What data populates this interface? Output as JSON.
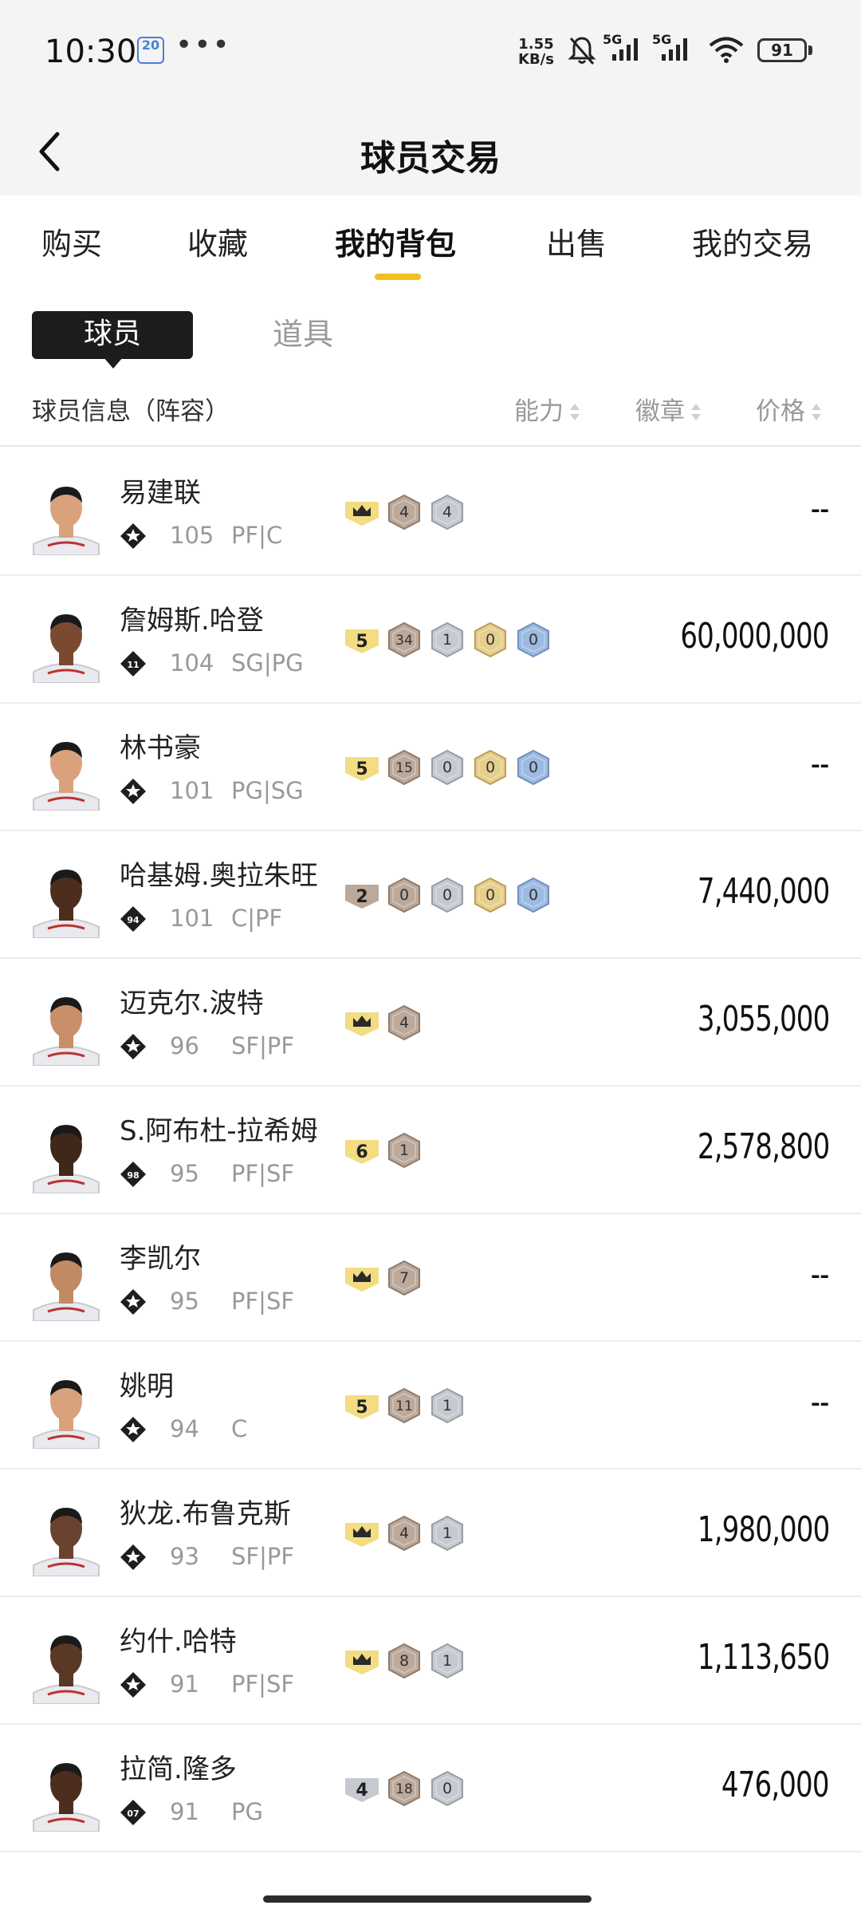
{
  "status_bar": {
    "time": "10:30",
    "calendar_day": "20",
    "dots": "•••",
    "net_speed_value": "1.55",
    "net_speed_unit": "KB/s",
    "signal1": "5G",
    "signal2": "5G",
    "battery": "91"
  },
  "header": {
    "title": "球员交易",
    "back_icon": "chevron-left-icon"
  },
  "tabs": [
    {
      "label": "购买",
      "active": false
    },
    {
      "label": "收藏",
      "active": false
    },
    {
      "label": "我的背包",
      "active": true
    },
    {
      "label": "出售",
      "active": false
    },
    {
      "label": "我的交易",
      "active": false
    }
  ],
  "segment": {
    "players": "球员",
    "items": "道具"
  },
  "columns": {
    "info": "球员信息（阵容）",
    "ability": "能力",
    "badge": "徽章",
    "price": "价格"
  },
  "colors": {
    "accent": "#f2c01e",
    "gold_chip": "#f3dc82",
    "bronze_chip": "#bca99a",
    "silver_chip": "#c7c9d1",
    "hof_chip": "#e5cf8e",
    "blue_chip": "#9dbbe0"
  },
  "players": [
    {
      "name": "易建联",
      "badge_label": "",
      "rating": "105",
      "position": "PF|C",
      "price": "--",
      "tier": {
        "kind": "crown",
        "label": ""
      },
      "chips": [
        {
          "color": "bronze",
          "value": "4"
        },
        {
          "color": "silver",
          "value": "4"
        }
      ]
    },
    {
      "name": "詹姆斯.哈登",
      "badge_label": "11",
      "rating": "104",
      "position": "SG|PG",
      "price": "60,000,000",
      "tier": {
        "kind": "gold",
        "label": "5"
      },
      "chips": [
        {
          "color": "bronze",
          "value": "34"
        },
        {
          "color": "silver",
          "value": "1"
        },
        {
          "color": "hof",
          "value": "0"
        },
        {
          "color": "blue",
          "value": "0"
        }
      ]
    },
    {
      "name": "林书豪",
      "badge_label": "",
      "rating": "101",
      "position": "PG|SG",
      "price": "--",
      "tier": {
        "kind": "gold",
        "label": "5"
      },
      "chips": [
        {
          "color": "bronze",
          "value": "15"
        },
        {
          "color": "silver",
          "value": "0"
        },
        {
          "color": "hof",
          "value": "0"
        },
        {
          "color": "blue",
          "value": "0"
        }
      ]
    },
    {
      "name": "哈基姆.奥拉朱旺",
      "badge_label": "94",
      "rating": "101",
      "position": "C|PF",
      "price": "7,440,000",
      "tier": {
        "kind": "bronze",
        "label": "2"
      },
      "chips": [
        {
          "color": "bronze",
          "value": "0"
        },
        {
          "color": "silver",
          "value": "0"
        },
        {
          "color": "hof",
          "value": "0"
        },
        {
          "color": "blue",
          "value": "0"
        }
      ]
    },
    {
      "name": "迈克尔.波特",
      "badge_label": "",
      "rating": "96",
      "position": "SF|PF",
      "price": "3,055,000",
      "tier": {
        "kind": "crown",
        "label": ""
      },
      "chips": [
        {
          "color": "bronze",
          "value": "4"
        }
      ]
    },
    {
      "name": "S.阿布杜-拉希姆",
      "badge_label": "98",
      "rating": "95",
      "position": "PF|SF",
      "price": "2,578,800",
      "tier": {
        "kind": "gold",
        "label": "6"
      },
      "chips": [
        {
          "color": "bronze",
          "value": "1"
        }
      ]
    },
    {
      "name": "李凯尔",
      "badge_label": "",
      "rating": "95",
      "position": "PF|SF",
      "price": "--",
      "tier": {
        "kind": "crown",
        "label": ""
      },
      "chips": [
        {
          "color": "bronze",
          "value": "7"
        }
      ]
    },
    {
      "name": "姚明",
      "badge_label": "",
      "rating": "94",
      "position": "C",
      "price": "--",
      "tier": {
        "kind": "gold",
        "label": "5"
      },
      "chips": [
        {
          "color": "bronze",
          "value": "11"
        },
        {
          "color": "silver",
          "value": "1"
        }
      ]
    },
    {
      "name": "狄龙.布鲁克斯",
      "badge_label": "",
      "rating": "93",
      "position": "SF|PF",
      "price": "1,980,000",
      "tier": {
        "kind": "crown",
        "label": ""
      },
      "chips": [
        {
          "color": "bronze",
          "value": "4"
        },
        {
          "color": "silver",
          "value": "1"
        }
      ]
    },
    {
      "name": "约什.哈特",
      "badge_label": "",
      "rating": "91",
      "position": "PF|SF",
      "price": "1,113,650",
      "tier": {
        "kind": "crown",
        "label": ""
      },
      "chips": [
        {
          "color": "bronze",
          "value": "8"
        },
        {
          "color": "silver",
          "value": "1"
        }
      ]
    },
    {
      "name": "拉简.隆多",
      "badge_label": "07",
      "rating": "91",
      "position": "PG",
      "price": "476,000",
      "tier": {
        "kind": "silver",
        "label": "4"
      },
      "chips": [
        {
          "color": "bronze",
          "value": "18"
        },
        {
          "color": "silver",
          "value": "0"
        }
      ]
    }
  ]
}
